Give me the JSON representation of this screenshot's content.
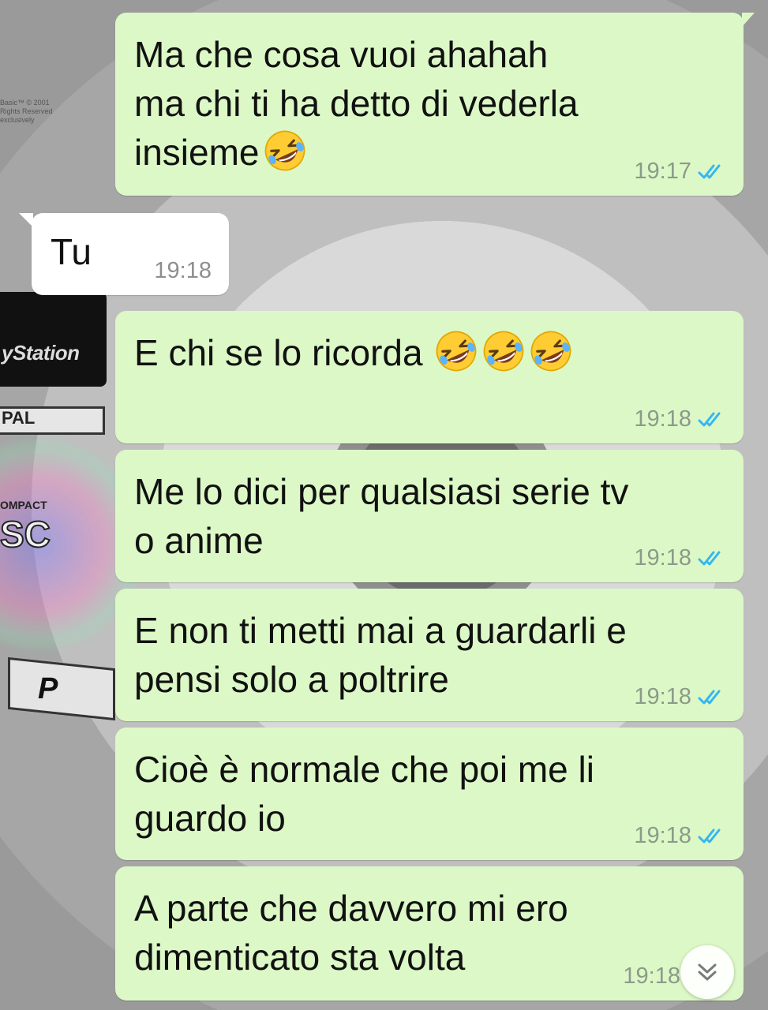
{
  "wallpaper": {
    "brand_text": "yStation",
    "pal_text": "PAL",
    "compact_text": "OMPACT",
    "disc_text": "SC",
    "p_text": "P",
    "fine_print": "Basic™ © 2001\nRights Reserved\nexclusively"
  },
  "messages": [
    {
      "direction": "out",
      "text": "Ma che cosa vuoi ahahah\nma chi ti ha detto di vederla\ninsieme",
      "emoji_count": 1,
      "time": "19:17",
      "status": "read"
    },
    {
      "direction": "in",
      "text": "Tu",
      "emoji_count": 0,
      "time": "19:18"
    },
    {
      "direction": "out",
      "text": "E chi se lo ricorda",
      "emoji_count": 3,
      "time": "19:18",
      "status": "read"
    },
    {
      "direction": "out",
      "text": "Me lo dici per qualsiasi serie tv\no anime",
      "emoji_count": 0,
      "time": "19:18",
      "status": "read"
    },
    {
      "direction": "out",
      "text": "E non ti metti mai a guardarli e\npensi solo a poltrire",
      "emoji_count": 0,
      "time": "19:18",
      "status": "read"
    },
    {
      "direction": "out",
      "text": "Cioè è normale che poi me li\nguardo io",
      "emoji_count": 0,
      "time": "19:18",
      "status": "read"
    },
    {
      "direction": "out",
      "text": "A parte che davvero mi ero\ndimenticato sta volta",
      "emoji_count": 0,
      "time": "19:18",
      "status": "read"
    }
  ],
  "emoji_name": "rolling-on-the-floor-laughing",
  "colors": {
    "outgoing_bubble": "#dcf8c6",
    "incoming_bubble": "#ffffff",
    "read_ticks": "#34b7f1",
    "timestamp": "#8c9a8a"
  },
  "scroll_button_icon": "chevron-double-down-icon"
}
